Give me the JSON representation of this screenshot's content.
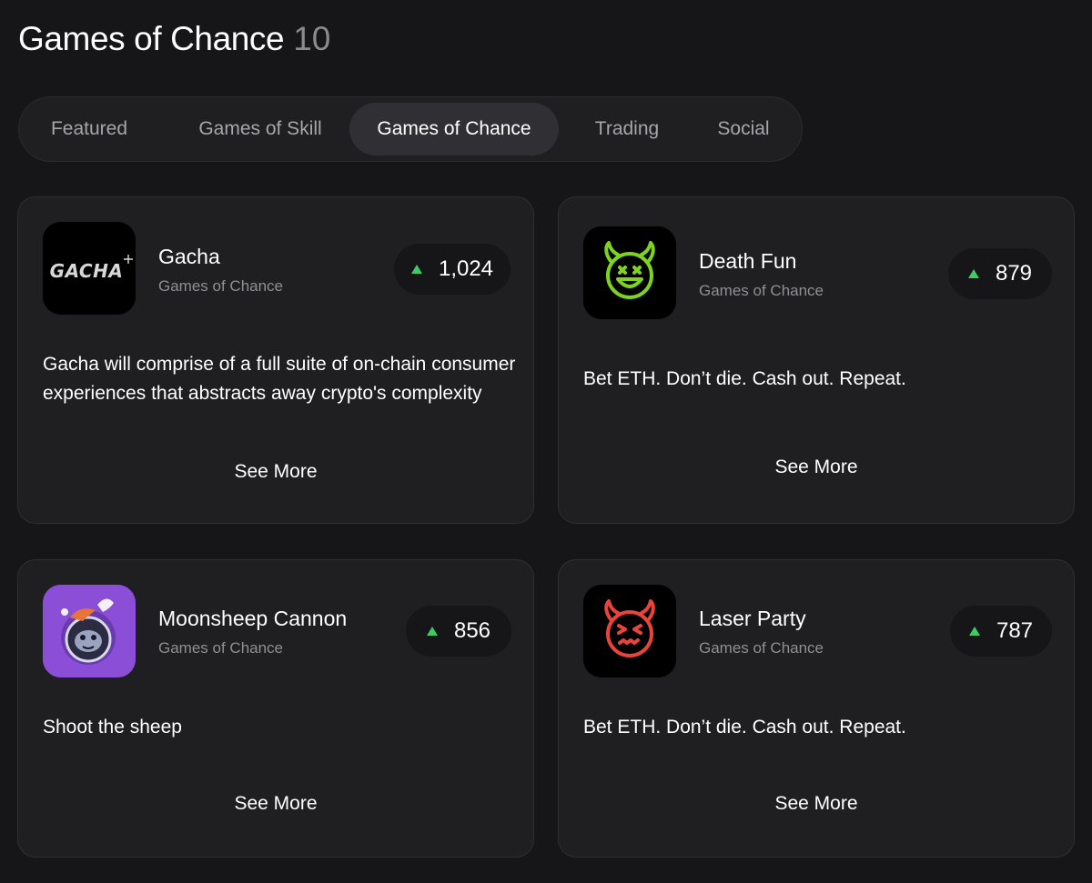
{
  "header": {
    "title": "Games of Chance",
    "count": "10"
  },
  "tabs": [
    {
      "label": "Featured",
      "active": false
    },
    {
      "label": "Games of Skill",
      "active": false
    },
    {
      "label": "Games of Chance",
      "active": true
    },
    {
      "label": "Trading",
      "active": false
    },
    {
      "label": "Social",
      "active": false
    }
  ],
  "cards": [
    {
      "name": "Gacha",
      "category": "Games of Chance",
      "votes": "1,024",
      "description": "Gacha will comprise of a full suite of on-chain consumer experiences that abstracts away crypto's complexity",
      "see_more": "See More",
      "logo": {
        "icon": "gacha-wordmark-icon",
        "text": "GACHA",
        "bg": "#000000"
      }
    },
    {
      "name": "Death Fun",
      "category": "Games of Chance",
      "votes": "879",
      "description": "Bet ETH. Don’t die. Cash out. Repeat.",
      "see_more": "See More",
      "logo": {
        "icon": "green-devil-face-icon",
        "color": "#7ed321",
        "bg": "#000000"
      }
    },
    {
      "name": "Moonsheep Cannon",
      "category": "Games of Chance",
      "votes": "856",
      "description": "Shoot the sheep",
      "see_more": "See More",
      "logo": {
        "icon": "astronaut-sheep-icon",
        "bg": "#8a4fd6"
      }
    },
    {
      "name": "Laser Party",
      "category": "Games of Chance",
      "votes": "787",
      "description": "Bet ETH. Don’t die. Cash out. Repeat.",
      "see_more": "See More",
      "logo": {
        "icon": "red-devil-face-icon",
        "color": "#e8443a",
        "bg": "#000000"
      }
    }
  ],
  "colors": {
    "background": "#161618",
    "card": "#1f1f22",
    "upvote": "#3fca68",
    "muted": "#8e8e94"
  }
}
